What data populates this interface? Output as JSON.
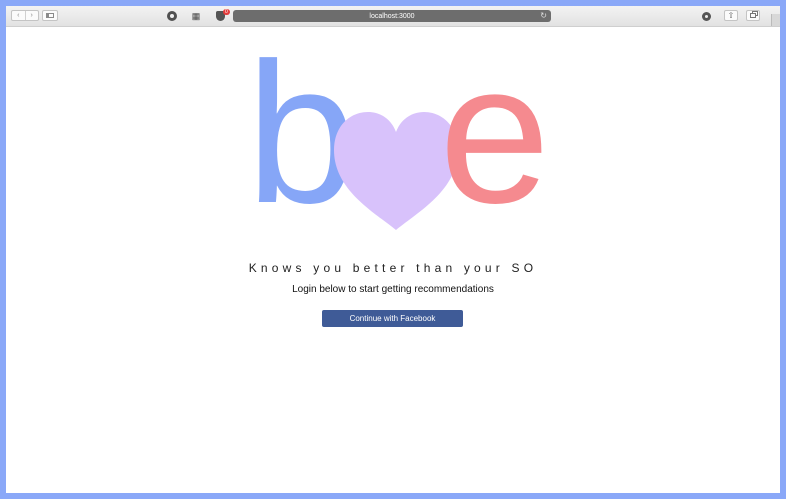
{
  "browser": {
    "address": "localhost:3000",
    "extension_badge": "0",
    "icons": {
      "back": "chevron-left-icon",
      "forward": "chevron-right-icon",
      "sidebar": "sidebar-icon",
      "reload": "reload-icon",
      "share": "share-icon",
      "tabs": "tabs-icon"
    }
  },
  "logo": {
    "letter_b": "b",
    "letter_e": "e",
    "colors": {
      "b": "#86a6f7",
      "heart": "#d8c2fb",
      "e": "#f58a8f"
    }
  },
  "main": {
    "tagline": "Knows you better than your SO",
    "subtitle": "Login below to start getting recommendations",
    "login_button": "Continue with Facebook",
    "login_button_color": "#3f5b97"
  }
}
